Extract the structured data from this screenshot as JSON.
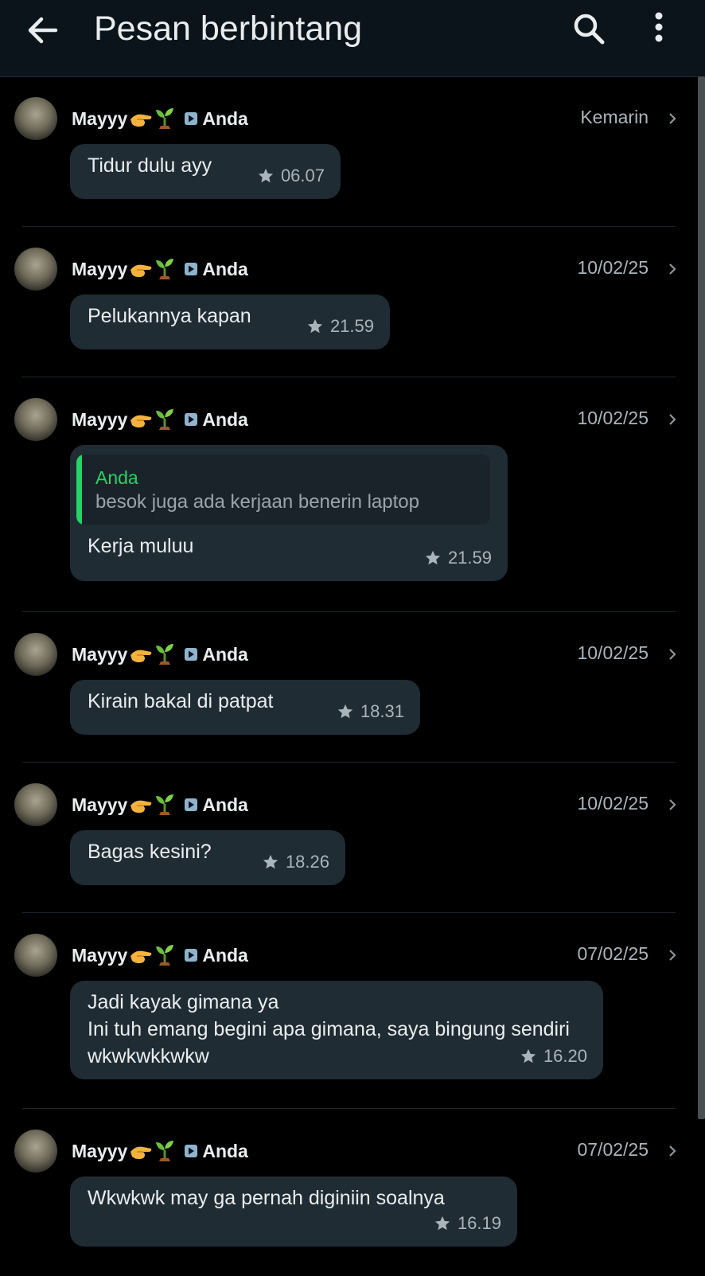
{
  "header": {
    "title": "Pesan berbintang",
    "back_icon": "arrow-left-icon",
    "search_icon": "search-icon",
    "more_icon": "more-vertical-icon"
  },
  "colors": {
    "background": "#000000",
    "topbar": "#0b141a",
    "bubble": "#202c33",
    "accent": "#25d366",
    "muted_text": "#aab4ba"
  },
  "messages": [
    {
      "sender": "Mayyy",
      "recipient": "Anda",
      "date": "Kemarin",
      "text": "Tidur dulu ayy",
      "time": "06.07"
    },
    {
      "sender": "Mayyy",
      "recipient": "Anda",
      "date": "10/02/25",
      "text": "Pelukannya kapan",
      "time": "21.59"
    },
    {
      "sender": "Mayyy",
      "recipient": "Anda",
      "date": "10/02/25",
      "quote_name": "Anda",
      "quote_text": "besok juga ada kerjaan benerin laptop",
      "text": "Kerja muluu",
      "time": "21.59"
    },
    {
      "sender": "Mayyy",
      "recipient": "Anda",
      "date": "10/02/25",
      "text": "Kirain bakal di patpat",
      "time": "18.31"
    },
    {
      "sender": "Mayyy",
      "recipient": "Anda",
      "date": "10/02/25",
      "text": "Bagas kesini?",
      "time": "18.26"
    },
    {
      "sender": "Mayyy",
      "recipient": "Anda",
      "date": "07/02/25",
      "text": "Jadi kayak gimana ya\nIni tuh emang begini apa gimana, saya bingung sendiri wkwkwkkwkw",
      "time": "16.20"
    },
    {
      "sender": "Mayyy",
      "recipient": "Anda",
      "date": "07/02/25",
      "text": "Wkwkwk may ga pernah diginiin soalnya",
      "time": "16.19"
    }
  ]
}
